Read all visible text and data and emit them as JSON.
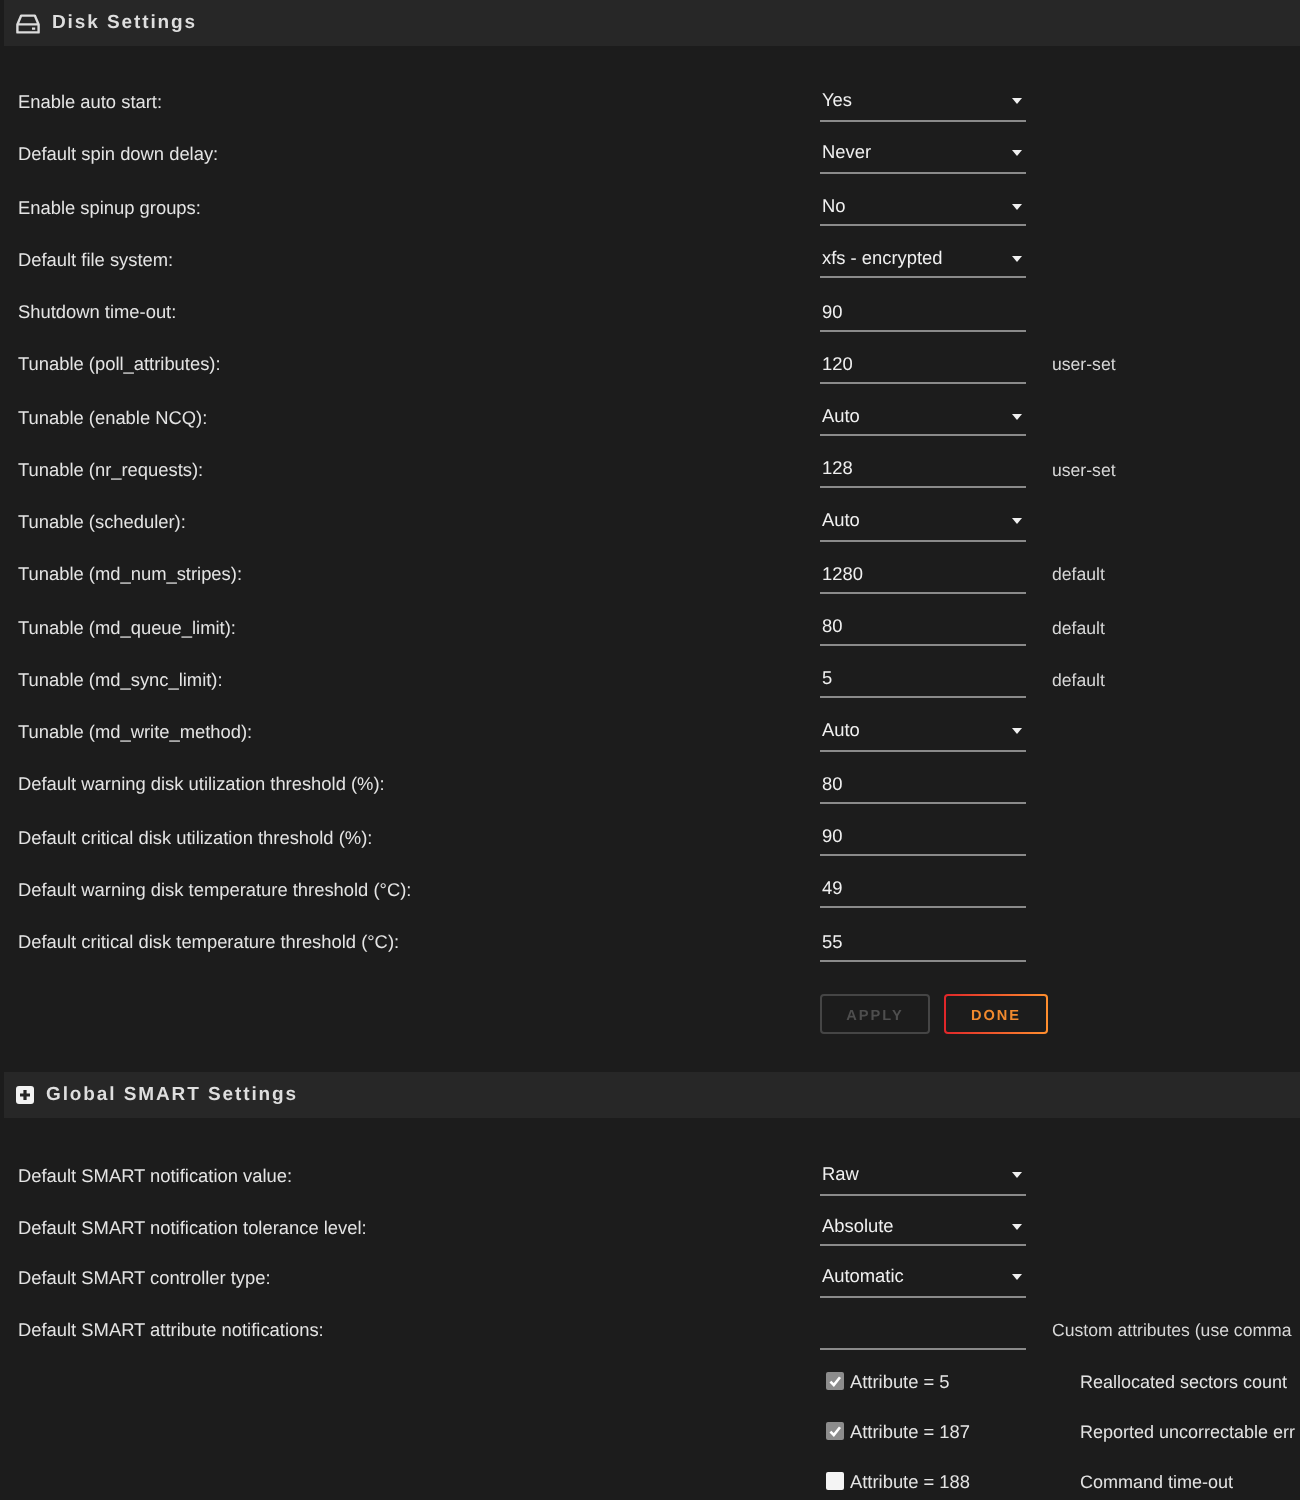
{
  "disk_settings": {
    "title": "Disk Settings",
    "rows": [
      {
        "label": "Enable auto start:",
        "kind": "select",
        "value": "Yes"
      },
      {
        "label": "Default spin down delay:",
        "kind": "select",
        "value": "Never"
      },
      {
        "label": "Enable spinup groups:",
        "kind": "select",
        "value": "No"
      },
      {
        "label": "Default file system:",
        "kind": "select",
        "value": "xfs - encrypted"
      },
      {
        "label": "Shutdown time-out:",
        "kind": "input",
        "value": "90"
      },
      {
        "label": "Tunable (poll_attributes):",
        "kind": "input",
        "value": "120",
        "note": "user-set"
      },
      {
        "label": "Tunable (enable NCQ):",
        "kind": "select",
        "value": "Auto"
      },
      {
        "label": "Tunable (nr_requests):",
        "kind": "input",
        "value": "128",
        "note": "user-set"
      },
      {
        "label": "Tunable (scheduler):",
        "kind": "select",
        "value": "Auto"
      },
      {
        "label": "Tunable (md_num_stripes):",
        "kind": "input",
        "value": "1280",
        "note": "default"
      },
      {
        "label": "Tunable (md_queue_limit):",
        "kind": "input",
        "value": "80",
        "note": "default"
      },
      {
        "label": "Tunable (md_sync_limit):",
        "kind": "input",
        "value": "5",
        "note": "default"
      },
      {
        "label": "Tunable (md_write_method):",
        "kind": "select",
        "value": "Auto"
      },
      {
        "label": "Default warning disk utilization threshold (%):",
        "kind": "input",
        "value": "80"
      },
      {
        "label": "Default critical disk utilization threshold (%):",
        "kind": "input",
        "value": "90"
      },
      {
        "label": "Default warning disk temperature threshold (°C):",
        "kind": "input",
        "value": "49"
      },
      {
        "label": "Default critical disk temperature threshold (°C):",
        "kind": "input",
        "value": "55"
      }
    ],
    "buttons": [
      {
        "label": "APPLY",
        "disabled": true
      },
      {
        "label": "DONE",
        "disabled": false
      }
    ]
  },
  "smart_settings": {
    "title": "Global SMART Settings",
    "rows": [
      {
        "label": "Default SMART notification value:",
        "kind": "select",
        "value": "Raw"
      },
      {
        "label": "Default SMART notification tolerance level:",
        "kind": "select",
        "value": "Absolute"
      },
      {
        "label": "Default SMART controller type:",
        "kind": "select",
        "value": "Automatic"
      },
      {
        "label": "Default SMART attribute notifications:",
        "kind": "input",
        "note": "Custom attributes (use comma"
      }
    ],
    "attributes": [
      {
        "label": "Attribute = 5",
        "checked": true,
        "description": "Reallocated sectors count"
      },
      {
        "label": "Attribute = 187",
        "checked": true,
        "description": "Reported uncorrectable err"
      },
      {
        "label": "Attribute = 188",
        "checked": false,
        "description": "Command time-out"
      }
    ]
  }
}
